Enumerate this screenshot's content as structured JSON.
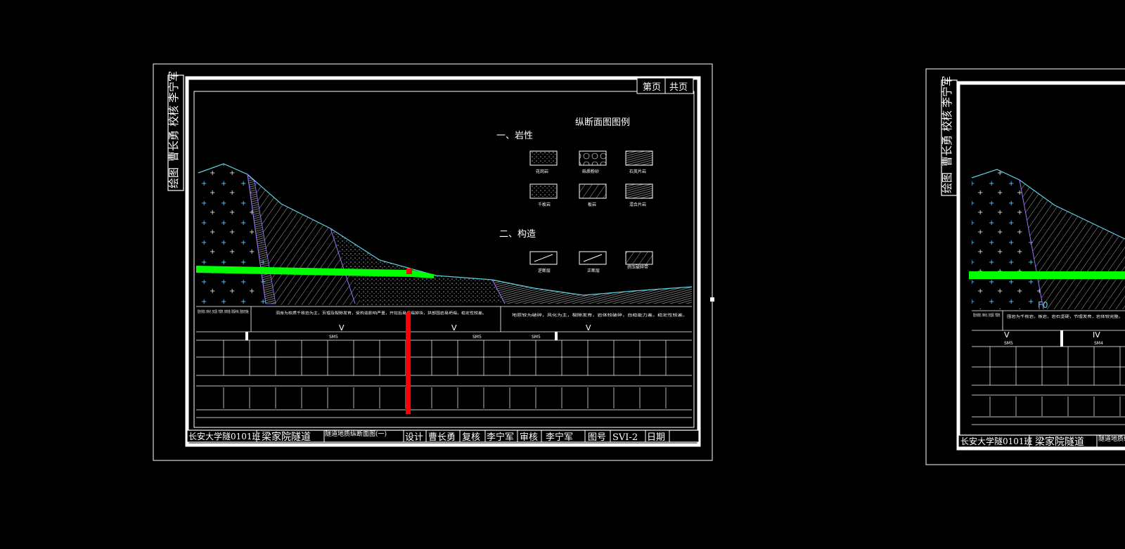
{
  "sheet": {
    "page_label": "第页",
    "total_label": "共页",
    "side_stamp": [
      "绘图",
      "曹长勇",
      "校核",
      "李宁军"
    ],
    "legend": {
      "title": "纵断面图图例",
      "section_rock": "一、岩性",
      "section_structure": "二、构造",
      "rock_items": [
        "花岗岩",
        "砾质粉砂",
        "石英片岩",
        "千枚岩",
        "板岩",
        "混合片岩"
      ],
      "structure_items": [
        "逆断层",
        "正断层",
        "挤压破碎带"
      ]
    },
    "descriptions": [
      "围岩为花岗岩，石英片岩，岩石坚硬，节理发育，岩体较完整，局部呈碎块状，围岩稳定性较差。",
      "洞身为软质千枚岩为主，页理及裂隙发育，受构造影响严重，开挖后易坍塌掉块，拱部围岩易坍塌，稳定性较差。",
      "地层较为破碎，风化为主，裂隙发育，岩体较破碎，自稳能力差，稳定性较差。"
    ],
    "grades": [
      "V",
      "V",
      "V"
    ],
    "segments": [
      "SM5",
      "SM5",
      "SM5"
    ],
    "title_block": {
      "school": "长安大学隧0101班",
      "project": "梁家院隧道",
      "drawing": "隧道地质纵断面图(一)",
      "design_label": "设计",
      "designer": "曹长勇",
      "review_label": "复核",
      "reviewer": "李宁军",
      "audit_label": "审核",
      "auditor": "李宁军",
      "figno_label": "图号",
      "figno": "SVI-2",
      "date_label": "日期"
    }
  },
  "sheet2": {
    "side_stamp": [
      "绘图",
      "曹长勇",
      "校核",
      "李宁军"
    ],
    "fault_label": "F0",
    "descriptions": [
      "围岩为花岗岩，石英片岩，岩石坚硬，节理发育。",
      "围岩为千枚岩，板岩，岩石坚硬，节理发育，岩体较完整。"
    ],
    "grades": [
      "V",
      "IV"
    ],
    "segments": [
      "SM5",
      "SM4"
    ],
    "title_block": {
      "school": "长安大学隧0101班",
      "project": "梁家院隧道",
      "drawing": "隧道地质纵"
    }
  },
  "colors": {
    "background": "#000000",
    "frame": "#ffffff",
    "terrain": "#5fd3e6",
    "granite_cross": "#5fc9f0",
    "tunnel_line": "#00ff00",
    "marker": "#ff0000"
  }
}
